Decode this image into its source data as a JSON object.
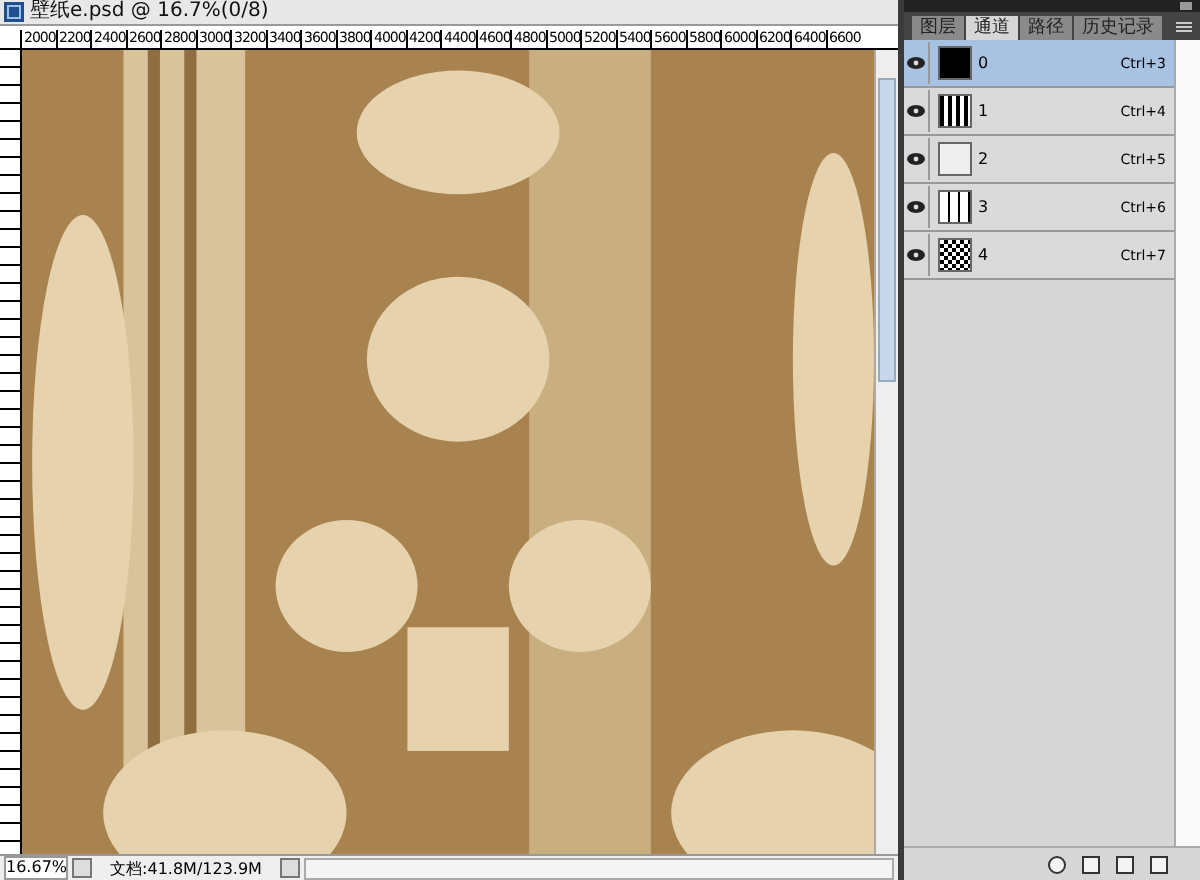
{
  "document": {
    "title": "壁纸e.psd @ 16.7%(0/8)",
    "ruler_labels": [
      "2000",
      "2200",
      "2400",
      "2600",
      "2800",
      "3000",
      "3200",
      "3400",
      "3600",
      "3800",
      "4000",
      "4200",
      "4400",
      "4600",
      "4800",
      "5000",
      "5200",
      "5400",
      "5600",
      "5800",
      "6000",
      "6200",
      "6400",
      "6600"
    ],
    "zoom": "16.67%",
    "doc_size": "文档:41.8M/123.9M"
  },
  "panel": {
    "tabs": [
      {
        "label": "图层",
        "selected": false
      },
      {
        "label": "通道",
        "selected": true
      },
      {
        "label": "路径",
        "selected": false
      },
      {
        "label": "历史记录",
        "selected": false
      }
    ],
    "channels": [
      {
        "name": "0",
        "shortcut": "Ctrl+3",
        "visible": true,
        "selected": true,
        "kind": "black"
      },
      {
        "name": "1",
        "shortcut": "Ctrl+4",
        "visible": true,
        "selected": false,
        "kind": "stripes"
      },
      {
        "name": "2",
        "shortcut": "Ctrl+5",
        "visible": true,
        "selected": false,
        "kind": "light"
      },
      {
        "name": "3",
        "shortcut": "Ctrl+6",
        "visible": true,
        "selected": false,
        "kind": "lines"
      },
      {
        "name": "4",
        "shortcut": "Ctrl+7",
        "visible": true,
        "selected": false,
        "kind": "pattern"
      }
    ]
  }
}
